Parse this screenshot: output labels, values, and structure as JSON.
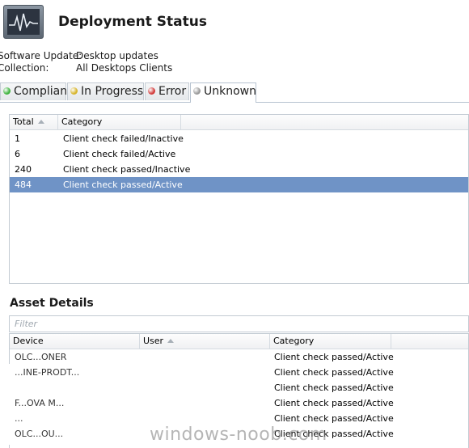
{
  "header": {
    "title": "Deployment Status",
    "icon": "status-monitor-icon",
    "software_update_label": "Software Update:",
    "software_update_value": "Desktop updates",
    "collection_label": "Collection:",
    "collection_value": "All Desktops Clients"
  },
  "tabs": [
    {
      "label": "Compliant",
      "status_color": "#3db33d"
    },
    {
      "label": "In Progress",
      "status_color": "#d6b42a"
    },
    {
      "label": "Error",
      "status_color": "#d23a3a"
    },
    {
      "label": "Unknown",
      "status_color": "#9a9a9a",
      "active": true
    }
  ],
  "summary_table": {
    "columns": [
      "Total",
      "Category"
    ],
    "rows": [
      {
        "total": "1",
        "category": "Client check failed/Inactive"
      },
      {
        "total": "6",
        "category": "Client check failed/Active"
      },
      {
        "total": "240",
        "category": "Client check passed/Inactive"
      },
      {
        "total": "484",
        "category": "Client check passed/Active",
        "selected": true
      }
    ]
  },
  "asset_details": {
    "title": "Asset Details",
    "filter_placeholder": "Filter",
    "columns": [
      "Device",
      "User",
      "Category"
    ],
    "rows": [
      {
        "device": "OLC...ONER",
        "category": "Client check passed/Active"
      },
      {
        "device": "...INE-PRODT...",
        "category": "Client check passed/Active"
      },
      {
        "device": "",
        "category": "Client check passed/Active"
      },
      {
        "device": "F...OVA M...",
        "category": "Client check passed/Active"
      },
      {
        "device": "...",
        "category": "Client check passed/Active"
      },
      {
        "device": "OLC...OU...",
        "category": "Client check passed/Active"
      }
    ]
  },
  "watermark": "windows-noob.com",
  "colors": {
    "selected_row": "#6f93c6",
    "border": "#c3cbd3"
  }
}
